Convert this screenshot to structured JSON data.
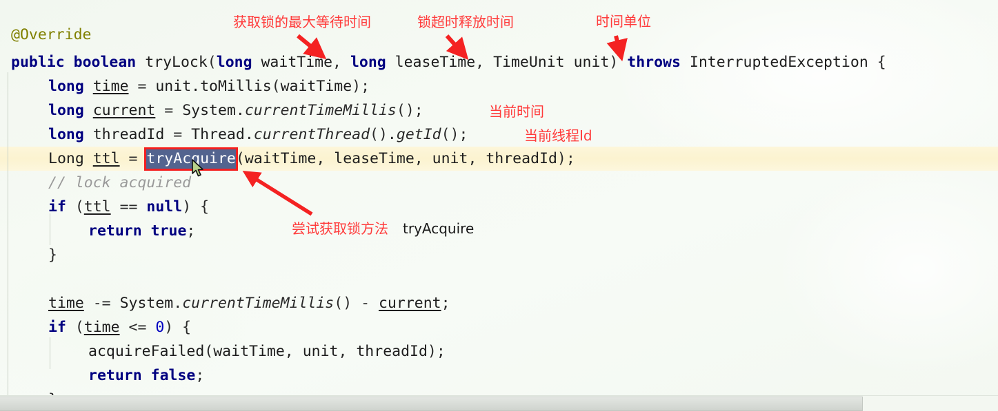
{
  "editor": {
    "background_color": "#f4f8f2",
    "highlight_line_color": "#fcf3d0",
    "selection_bg_color": "#53648f",
    "selection_border_color": "#f41f1f",
    "keyword_color": "#000080",
    "annotation_color": "#808000",
    "comment_color": "#9a9a9a",
    "note_color": "#ff3b3b",
    "code_lines": [
      {
        "indent": 0,
        "text": "@Override"
      },
      {
        "indent": 0,
        "text": "public boolean tryLock(long waitTime, long leaseTime, TimeUnit unit) throws InterruptedException {"
      },
      {
        "indent": 1,
        "text": "long time = unit.toMillis(waitTime);"
      },
      {
        "indent": 1,
        "text": "long current = System.currentTimeMillis();"
      },
      {
        "indent": 1,
        "text": "long threadId = Thread.currentThread().getId();"
      },
      {
        "indent": 1,
        "text": "Long ttl = tryAcquire(waitTime, leaseTime, unit, threadId);"
      },
      {
        "indent": 1,
        "text": "// lock acquired"
      },
      {
        "indent": 1,
        "text": "if (ttl == null) {"
      },
      {
        "indent": 2,
        "text": "return true;"
      },
      {
        "indent": 1,
        "text": "}"
      },
      {
        "indent": 0,
        "text": ""
      },
      {
        "indent": 1,
        "text": "time -= System.currentTimeMillis() - current;"
      },
      {
        "indent": 1,
        "text": "if (time <= 0) {"
      },
      {
        "indent": 2,
        "text": "acquireFailed(waitTime, unit, threadId);"
      },
      {
        "indent": 2,
        "text": "return false;"
      },
      {
        "indent": 1,
        "text": "}"
      }
    ],
    "tokens": {
      "override_annotation": "@Override",
      "kw_public": "public",
      "kw_boolean": "boolean",
      "method_tryLock": "tryLock",
      "kw_long": "long",
      "param_waitTime": "waitTime",
      "param_leaseTime": "leaseTime",
      "type_TimeUnit": "TimeUnit",
      "param_unit": "unit",
      "kw_throws": "throws",
      "type_InterruptedException": "InterruptedException",
      "var_time": "time",
      "call_toMillis": "unit.toMillis",
      "var_current": "current",
      "call_currentTimeMillis": "currentTimeMillis",
      "var_threadId": "threadId",
      "call_currentThread": "currentThread",
      "call_getId": "getId",
      "type_Long": "Long",
      "var_ttl": "ttl",
      "call_tryAcquire": "tryAcquire",
      "comment_lock_acquired": "// lock acquired",
      "kw_if": "if",
      "kw_null": "null",
      "kw_return": "return",
      "lit_true": "true",
      "lit_false": "false",
      "num_zero": "0",
      "call_acquireFailed": "acquireFailed",
      "class_System": "System",
      "class_Thread": "Thread"
    },
    "selected_text": "tryAcquire"
  },
  "annotations": [
    {
      "id": "max-wait-time",
      "text": "获取锁的最大等待时间"
    },
    {
      "id": "lease-release-time",
      "text": "锁超时释放时间"
    },
    {
      "id": "time-unit",
      "text": "时间单位"
    },
    {
      "id": "current-time",
      "text": "当前时间"
    },
    {
      "id": "current-thread-id",
      "text": "当前线程Id"
    },
    {
      "id": "try-acquire-method",
      "text": "尝试获取锁方法"
    },
    {
      "id": "try-acquire-name",
      "text": "tryAcquire"
    }
  ]
}
